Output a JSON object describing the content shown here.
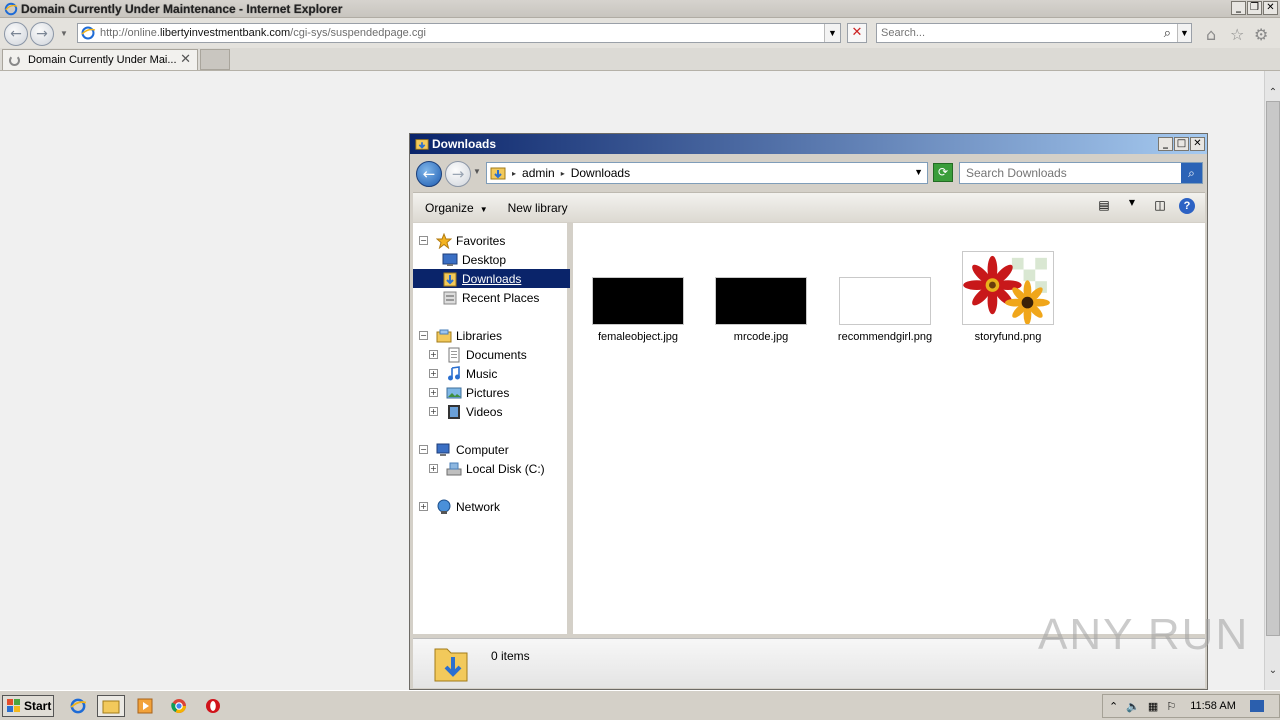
{
  "ie": {
    "title": "Domain Currently Under Maintenance - Internet Explorer",
    "url_prefix": "http://online.",
    "url_domain": "libertyinvestmentbank.com",
    "url_path": "/cgi-sys/suspendedpage.cgi",
    "search_placeholder": "Search...",
    "tab_label": "Domain Currently Under Mai...",
    "window_buttons": [
      "_",
      "❐",
      "✕"
    ]
  },
  "explorer": {
    "title": "Downloads",
    "path": [
      "admin",
      "Downloads"
    ],
    "search_placeholder": "Search Downloads",
    "toolbar": {
      "organize": "Organize",
      "new_library": "New library"
    },
    "nav": {
      "favorites": "Favorites",
      "desktop": "Desktop",
      "downloads": "Downloads",
      "recent_places": "Recent Places",
      "libraries": "Libraries",
      "documents": "Documents",
      "music": "Music",
      "pictures": "Pictures",
      "videos": "Videos",
      "computer": "Computer",
      "local_disk": "Local Disk (C:)",
      "network": "Network"
    },
    "files": [
      {
        "name": "femaleobject.jpg",
        "thumb": "black"
      },
      {
        "name": "mrcode.jpg",
        "thumb": "black"
      },
      {
        "name": "recommendgirl.png",
        "thumb": "white"
      },
      {
        "name": "storyfund.png",
        "thumb": "flowers"
      }
    ],
    "status": "0 items"
  },
  "watermark": "ANY RUN",
  "taskbar": {
    "start": "Start",
    "clock": "11:58 AM"
  },
  "colors": {
    "selection": "#0a246a",
    "titlebar_start": "#0a246a",
    "titlebar_end": "#a6caf0"
  }
}
